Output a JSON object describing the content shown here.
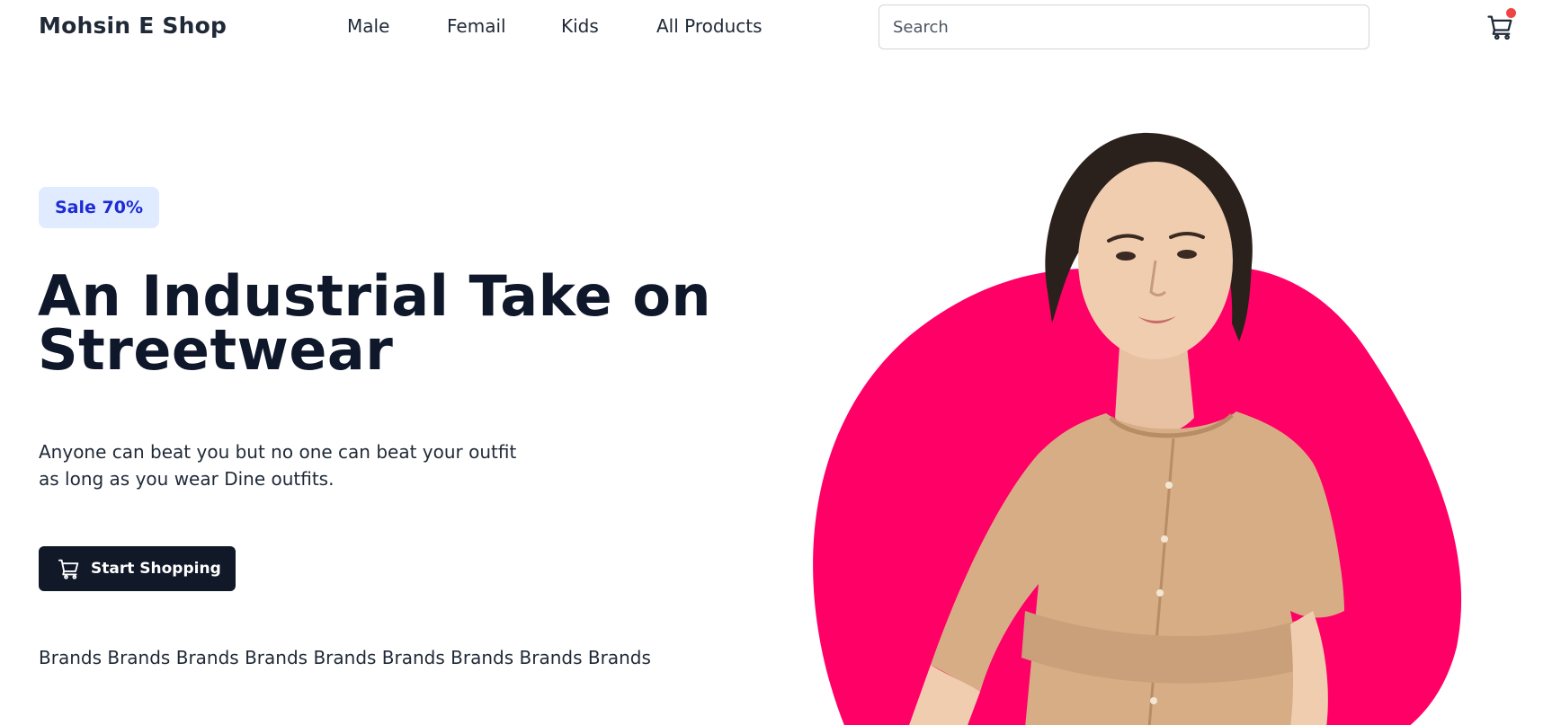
{
  "brand": {
    "name": "Mohsin E Shop"
  },
  "nav": {
    "links": [
      {
        "label": "Male"
      },
      {
        "label": "Femail"
      },
      {
        "label": "Kids"
      },
      {
        "label": "All Products"
      }
    ]
  },
  "search": {
    "placeholder": "Search",
    "value": ""
  },
  "cart": {
    "icon": "cart-icon",
    "has_notification": true,
    "dot_color": "#ef4444"
  },
  "hero": {
    "badge": "Sale 70%",
    "title_line1": "An Industrial Take on",
    "title_line2": "Streetwear",
    "subtitle_line1": "Anyone can beat you but no one can beat your outfit",
    "subtitle_line2": "as long as you wear Dine outfits.",
    "cta_label": "Start Shopping",
    "cta_icon": "cart-icon",
    "brands": [
      "Brands",
      "Brands",
      "Brands",
      "Brands",
      "Brands",
      "Brands",
      "Brands",
      "Brands",
      "Brands"
    ],
    "image": "woman-in-beige-dress-photo"
  },
  "colors": {
    "accent_pink": "#ff0066",
    "badge_bg": "#e0ebff",
    "badge_text": "#1d2bd6",
    "cta_bg": "#111827",
    "text_dark": "#0f172a"
  }
}
